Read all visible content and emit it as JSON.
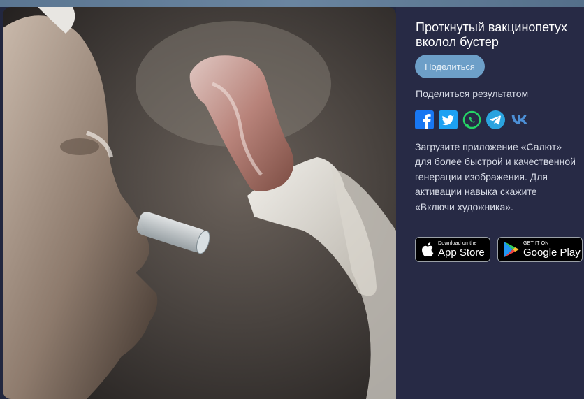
{
  "header": {
    "title": "Проткнутый вакцинопетух вколол бустер"
  },
  "actions": {
    "share_button": "Поделиться",
    "share_result_label": "Поделиться результатом"
  },
  "social": [
    {
      "name": "facebook-icon",
      "color": "#1877f2"
    },
    {
      "name": "twitter-icon",
      "color": "#1da1f2"
    },
    {
      "name": "whatsapp-icon",
      "color": "#25d366"
    },
    {
      "name": "telegram-icon",
      "color": "#2aa3df"
    },
    {
      "name": "vk-icon",
      "color": "#4c8fd6"
    }
  ],
  "promo": {
    "text": "Загрузите приложение «Салют» для более быстрой и качественной генерации изображения. Для активации навыка скажите «Включи художника»."
  },
  "stores": {
    "apple_small": "Download on the",
    "apple_big": "App Store",
    "google_small": "GET IT ON",
    "google_big": "Google Play"
  },
  "colors": {
    "background": "#22273f",
    "sidebar": "#272a45",
    "share_button": "#6d9fc8"
  }
}
